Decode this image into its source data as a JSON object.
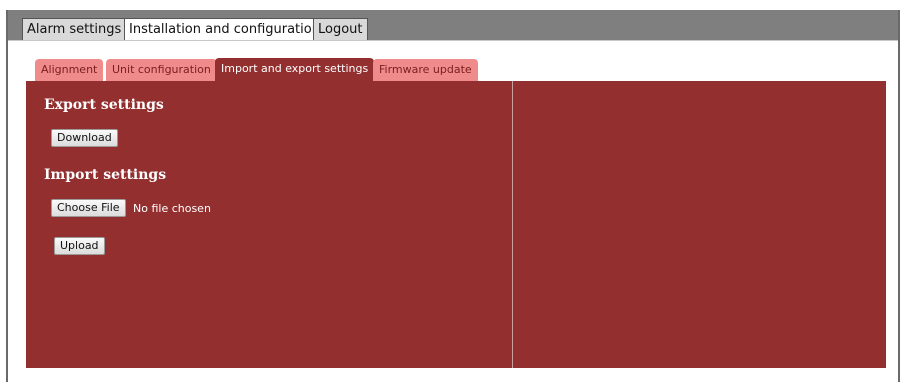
{
  "main_tabs": [
    {
      "label": "Alarm settings"
    },
    {
      "label": "Installation and configuration"
    },
    {
      "label": "Logout"
    }
  ],
  "sub_tabs": [
    {
      "label": "Alignment"
    },
    {
      "label": "Unit configuration"
    },
    {
      "label": "Import and export settings"
    },
    {
      "label": "Firmware update"
    }
  ],
  "export": {
    "title": "Export settings",
    "download_label": "Download"
  },
  "import": {
    "title": "Import settings",
    "choose_file_label": "Choose File",
    "file_status": "No file chosen",
    "upload_label": "Upload"
  },
  "colors": {
    "panel": "#932f2f",
    "inactive_tab": "#f08b8b",
    "topbar": "#7f7f7f"
  }
}
